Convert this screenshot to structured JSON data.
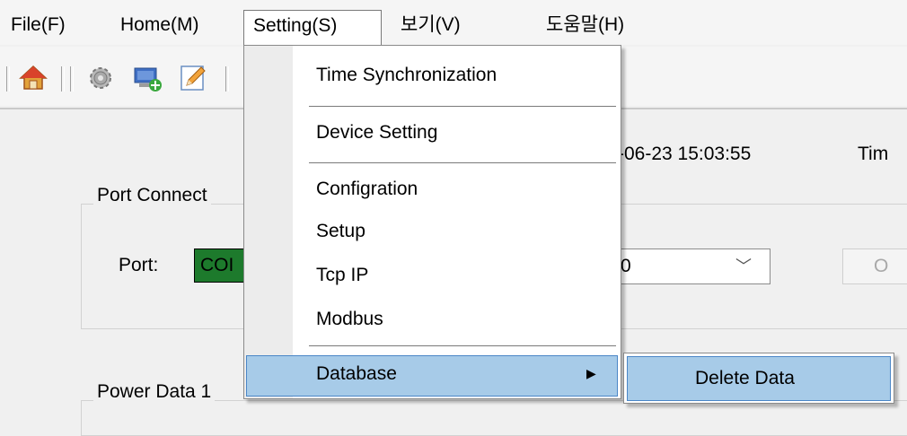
{
  "menubar": {
    "items": [
      {
        "label": "File(F)"
      },
      {
        "label": "Home(M)"
      },
      {
        "label": "Setting(S)"
      },
      {
        "label": "보기(V)"
      },
      {
        "label": "도움말(H)"
      }
    ]
  },
  "toolbar": {
    "icons": [
      "home-icon",
      "gear-icon",
      "monitor-add-icon",
      "edit-icon"
    ]
  },
  "main": {
    "datetime": "-06-23 15:03:55",
    "time_label": "Tim",
    "port_group_label": "Port Connect",
    "port_label": "Port:",
    "port_value": "COI",
    "combo_value": "0",
    "combo_arrow": "﹀",
    "open_button": "O",
    "power_group_label": "Power Data 1"
  },
  "dropdown": {
    "items": [
      {
        "label": "Time Synchronization"
      },
      {
        "label": "Device Setting"
      },
      {
        "label": "Configration"
      },
      {
        "label": "Setup"
      },
      {
        "label": "Tcp IP"
      },
      {
        "label": "Modbus"
      },
      {
        "label": "Database"
      }
    ],
    "submenu_arrow": "▶"
  },
  "submenu": {
    "items": [
      {
        "label": "Delete Data"
      }
    ]
  },
  "colors": {
    "highlight": "#a7cbe8",
    "highlight_border": "#4a86c7",
    "port_field": "#1d7a2c"
  }
}
